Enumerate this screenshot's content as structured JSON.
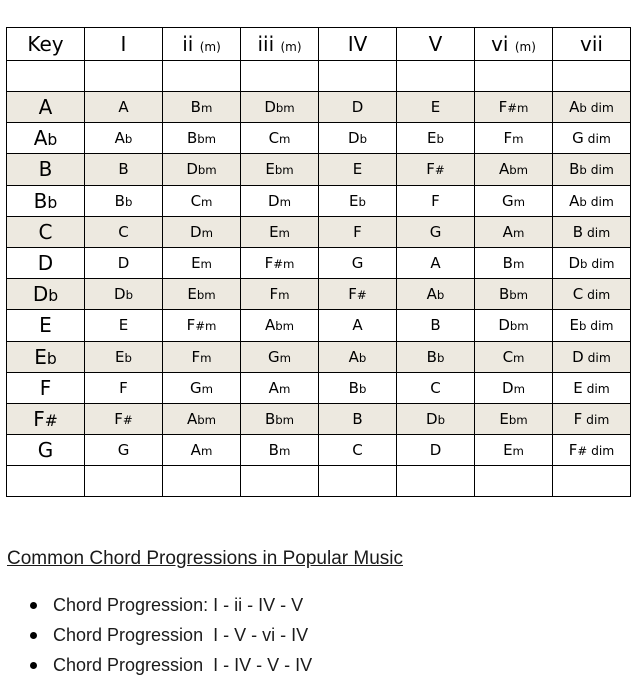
{
  "table": {
    "headers": [
      {
        "main": "Key",
        "sub": ""
      },
      {
        "main": "I",
        "sub": ""
      },
      {
        "main": "ii",
        "sub": "(m)"
      },
      {
        "main": "iii",
        "sub": "(m)"
      },
      {
        "main": "IV",
        "sub": ""
      },
      {
        "main": "V",
        "sub": ""
      },
      {
        "main": "vi",
        "sub": "(m)"
      },
      {
        "main": "vii",
        "sub": ""
      }
    ],
    "rows": [
      {
        "shaded": true,
        "cells": [
          "A",
          "A",
          "Bm",
          "Dbm",
          "D",
          "E",
          "F#m",
          "Ab dim"
        ]
      },
      {
        "shaded": false,
        "cells": [
          "Ab",
          "Ab",
          "Bbm",
          "Cm",
          "Db",
          "Eb",
          "Fm",
          "G dim"
        ]
      },
      {
        "shaded": true,
        "cells": [
          "B",
          "B",
          "Dbm",
          "Ebm",
          "E",
          "F#",
          "Abm",
          "Bb dim"
        ]
      },
      {
        "shaded": false,
        "cells": [
          "Bb",
          "Bb",
          "Cm",
          "Dm",
          "Eb",
          "F",
          "Gm",
          "Ab dim"
        ]
      },
      {
        "shaded": true,
        "cells": [
          "C",
          "C",
          "Dm",
          "Em",
          "F",
          "G",
          "Am",
          "B dim"
        ]
      },
      {
        "shaded": false,
        "cells": [
          "D",
          "D",
          "Em",
          "F#m",
          "G",
          "A",
          "Bm",
          "Db dim"
        ]
      },
      {
        "shaded": true,
        "cells": [
          "Db",
          "Db",
          "Ebm",
          "Fm",
          "F#",
          "Ab",
          "Bbm",
          "C dim"
        ]
      },
      {
        "shaded": false,
        "cells": [
          "E",
          "E",
          "F#m",
          "Abm",
          "A",
          "B",
          "Dbm",
          "Eb dim"
        ]
      },
      {
        "shaded": true,
        "cells": [
          "Eb",
          "Eb",
          "Fm",
          "Gm",
          "Ab",
          "Bb",
          "Cm",
          "D dim"
        ]
      },
      {
        "shaded": false,
        "cells": [
          "F",
          "F",
          "Gm",
          "Am",
          "Bb",
          "C",
          "Dm",
          "E dim"
        ]
      },
      {
        "shaded": true,
        "cells": [
          "F#",
          "F#",
          "Abm",
          "Bbm",
          "B",
          "Db",
          "Ebm",
          "F dim"
        ]
      },
      {
        "shaded": false,
        "cells": [
          "G",
          "G",
          "Am",
          "Bm",
          "C",
          "D",
          "Em",
          "F# dim"
        ]
      }
    ],
    "shade_color": "#ede9e0"
  },
  "section": {
    "title": "Common Chord Progressions in Popular Music",
    "progressions": [
      "Chord Progression: I - ii - IV - V",
      "Chord Progression  I - V - vi - IV",
      "Chord Progression  I - IV - V - IV"
    ]
  }
}
